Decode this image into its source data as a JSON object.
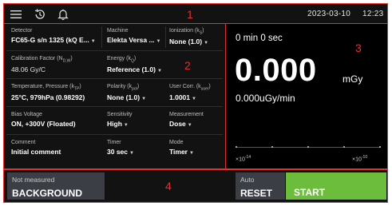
{
  "topbar": {
    "date": "2023-03-10",
    "time": "12:23",
    "icons": [
      "menu-icon",
      "history-icon",
      "bell-icon"
    ]
  },
  "zones": [
    "1",
    "2",
    "3",
    "4"
  ],
  "settings": {
    "detector": {
      "label": "Detector",
      "value": "FC65-G s/n 1325 (kQ E..."
    },
    "machine": {
      "label": "Machine",
      "value": "Elekta Versa ..."
    },
    "ionization": {
      "label": "Ionization (k",
      "sub": "S",
      "tail": ")",
      "value": "None (1.0)"
    },
    "calibration": {
      "label": "Calibration Factor (N",
      "sub": "D,W",
      "tail": ")",
      "value": "48.06 Gy/C"
    },
    "energy": {
      "label": "Energy (k",
      "sub": "Q",
      "tail": ")",
      "value": "Reference (1.0)"
    },
    "temperature": {
      "label": "Temperature, Pressure (k",
      "sub": "TP",
      "tail": ")",
      "value": "25°C, 979hPa (0.98292)"
    },
    "polarity": {
      "label": "Polarity (k",
      "sub": "pol",
      "tail": ")",
      "value": "None (1.0)"
    },
    "user_corr": {
      "label": "User Corr. (k",
      "sub": "user",
      "tail": ")",
      "value": "1.0001"
    },
    "bias": {
      "label": "Bias Voltage",
      "value": "ON, +300V (Floated)"
    },
    "sensitivity": {
      "label": "Sensitivity",
      "value": "High"
    },
    "measurement": {
      "label": "Measurement",
      "value": "Dose"
    },
    "comment": {
      "label": "Comment",
      "value": "Initial comment"
    },
    "timer": {
      "label": "Timer",
      "value": "30 sec"
    },
    "mode": {
      "label": "Mode",
      "value": "Timer"
    }
  },
  "readout": {
    "elapsed": "0 min  0 sec",
    "dose_value": "0.000",
    "dose_unit": "mGy",
    "rate": "0.000uGy/min",
    "scale_min": "×10",
    "scale_min_exp": "-14",
    "scale_max": "×10",
    "scale_max_exp": "-10"
  },
  "bottom": {
    "background_status": "Not measured",
    "background_label": "BACKGROUND",
    "reset_mode": "Auto",
    "reset_label": "RESET",
    "start_label": "START"
  },
  "colors": {
    "zone_border": "#e53030",
    "panel_bg": "#121212",
    "readout_bg": "#000000",
    "button_gray": "#3b3e45",
    "start_green": "#6dbd3c"
  }
}
